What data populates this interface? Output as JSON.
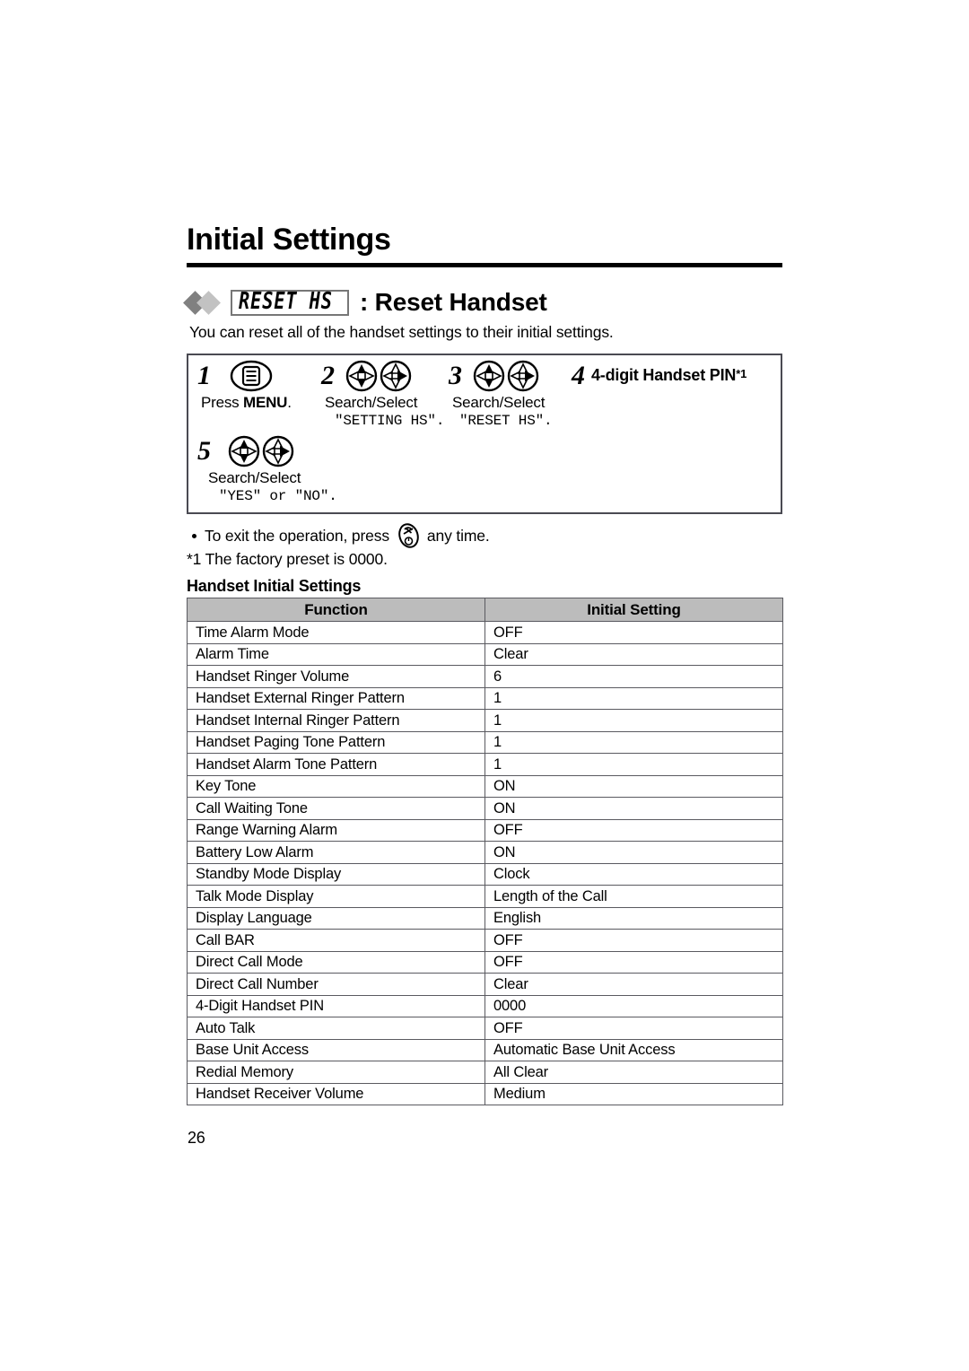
{
  "page": {
    "title": "Initial Settings",
    "number": "26"
  },
  "section": {
    "lcd_label": "RESET HS",
    "title": ": Reset Handset",
    "intro": "You can reset all of the handset settings to their initial settings."
  },
  "steps": [
    {
      "num": "1",
      "icon": "menu-key-icon",
      "label_prefix": "Press ",
      "label_bold": "MENU",
      "label_suffix": ".",
      "mono": ""
    },
    {
      "num": "2",
      "icon": "navigator-search-select-icon",
      "label": "Search/Select",
      "mono": "\"SETTING HS\"."
    },
    {
      "num": "3",
      "icon": "navigator-search-select-icon",
      "label": "Search/Select",
      "mono": "\"RESET HS\"."
    },
    {
      "num": "4",
      "icon": "none",
      "bold_text": "4-digit Handset PIN",
      "footnote_marker": "*1"
    },
    {
      "num": "5",
      "icon": "navigator-search-select-icon",
      "label": "Search/Select",
      "mono": "\"YES\" or \"NO\"."
    }
  ],
  "notes": {
    "exit_prefix": "To exit the operation, press",
    "exit_icon": "power-off-key-icon",
    "exit_suffix": "any time.",
    "footnote": "*1 The factory preset is 0000."
  },
  "table": {
    "caption": "Handset Initial Settings",
    "headers": [
      "Function",
      "Initial Setting"
    ],
    "header_bg": "#bcbcbc",
    "rows": [
      [
        "Time Alarm Mode",
        "OFF"
      ],
      [
        "Alarm Time",
        "Clear"
      ],
      [
        "Handset Ringer Volume",
        "6"
      ],
      [
        "Handset External Ringer Pattern",
        "1"
      ],
      [
        "Handset Internal Ringer Pattern",
        "1"
      ],
      [
        "Handset Paging Tone Pattern",
        "1"
      ],
      [
        "Handset Alarm Tone Pattern",
        "1"
      ],
      [
        "Key Tone",
        "ON"
      ],
      [
        "Call Waiting Tone",
        "ON"
      ],
      [
        "Range Warning Alarm",
        "OFF"
      ],
      [
        "Battery Low Alarm",
        "ON"
      ],
      [
        "Standby Mode Display",
        "Clock"
      ],
      [
        "Talk Mode Display",
        "Length of the Call"
      ],
      [
        "Display Language",
        "English"
      ],
      [
        "Call BAR",
        "OFF"
      ],
      [
        "Direct Call Mode",
        "OFF"
      ],
      [
        "Direct Call Number",
        "Clear"
      ],
      [
        "4-Digit Handset PIN",
        "0000"
      ],
      [
        "Auto Talk",
        "OFF"
      ],
      [
        "Base Unit Access",
        "Automatic Base Unit Access"
      ],
      [
        "Redial Memory",
        "All Clear"
      ],
      [
        "Handset Receiver Volume",
        "Medium"
      ]
    ]
  },
  "colors": {
    "diamond_dark": "#808080",
    "diamond_light": "#c2c2c2",
    "rule": "#000000",
    "border": "#4a4a52"
  }
}
